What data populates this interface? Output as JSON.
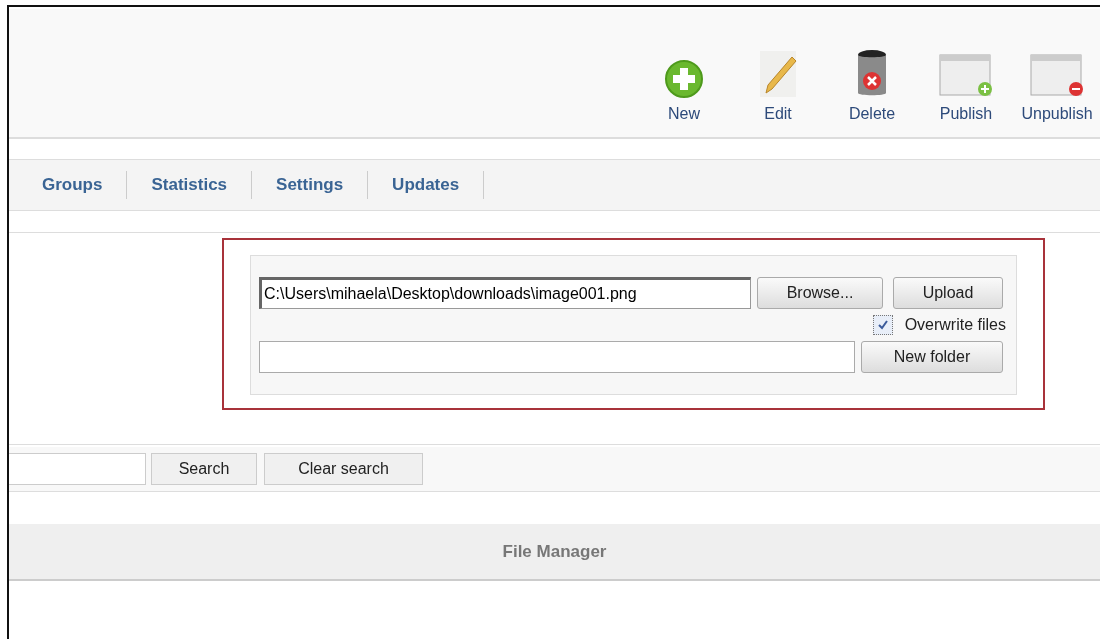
{
  "toolbar": [
    {
      "kind": "new",
      "label": "New"
    },
    {
      "kind": "edit",
      "label": "Edit"
    },
    {
      "kind": "delete",
      "label": "Delete"
    },
    {
      "kind": "publish",
      "label": "Publish"
    },
    {
      "kind": "unpublish",
      "label": "Unpublish"
    }
  ],
  "tabs": [
    "Groups",
    "Statistics",
    "Settings",
    "Updates"
  ],
  "upload": {
    "file_value": "C:\\Users\\mihaela\\Desktop\\downloads\\image001.png",
    "browse": "Browse...",
    "upload": "Upload",
    "overwrite": {
      "label": "Overwrite files",
      "checked": true
    },
    "new_folder": "New folder"
  },
  "search": {
    "search": "Search",
    "clear": "Clear search"
  },
  "header": "File Manager"
}
